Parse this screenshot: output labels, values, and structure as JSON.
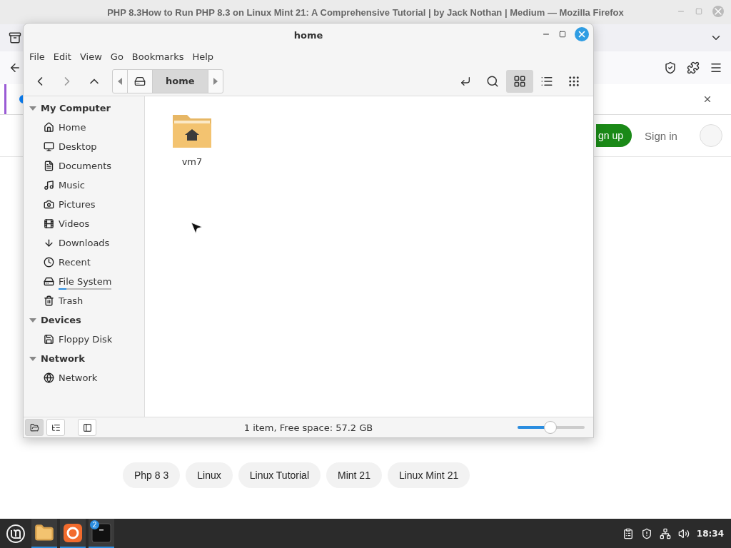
{
  "browser": {
    "title": "PHP 8.3How to Run PHP 8.3 on Linux Mint 21: A Comprehensive Tutorial | by Jack Nothan | Medium — Mozilla Firefox",
    "header": {
      "signup": "gn up",
      "signin": "Sign in"
    },
    "tags": [
      "Php 8 3",
      "Linux",
      "Linux Tutorial",
      "Mint 21",
      "Linux Mint 21"
    ]
  },
  "file_manager": {
    "title": "home",
    "menu": [
      "File",
      "Edit",
      "View",
      "Go",
      "Bookmarks",
      "Help"
    ],
    "path": [
      {
        "kind": "drive",
        "selected": false
      },
      {
        "kind": "folder",
        "label": "home",
        "selected": true
      }
    ],
    "views": [
      {
        "kind": "icons",
        "selected": true
      },
      {
        "kind": "list",
        "selected": false
      },
      {
        "kind": "compact",
        "selected": false
      }
    ],
    "sidebar": [
      {
        "heading": "My Computer",
        "expanded": true,
        "items": [
          {
            "label": "Home"
          },
          {
            "label": "Desktop"
          },
          {
            "label": "Documents"
          },
          {
            "label": "Music"
          },
          {
            "label": "Pictures"
          },
          {
            "label": "Videos"
          },
          {
            "label": "Downloads"
          },
          {
            "label": "Recent"
          },
          {
            "label": "File System",
            "level": 0.15
          },
          {
            "label": "Trash"
          }
        ]
      },
      {
        "heading": "Devices",
        "expanded": true,
        "items": [
          {
            "label": "Floppy Disk"
          }
        ]
      },
      {
        "heading": "Network",
        "expanded": true,
        "items": [
          {
            "label": "Network"
          }
        ]
      }
    ],
    "files": [
      {
        "name": "vm7",
        "selected": false
      }
    ],
    "pane_modes": [
      {
        "selected": true
      },
      {
        "selected": false
      }
    ],
    "status": "1 item, Free space: 57.2 GB",
    "zoom": {
      "level": 0.49
    }
  },
  "taskbar": {
    "badge": "2",
    "clock": "18:34"
  }
}
